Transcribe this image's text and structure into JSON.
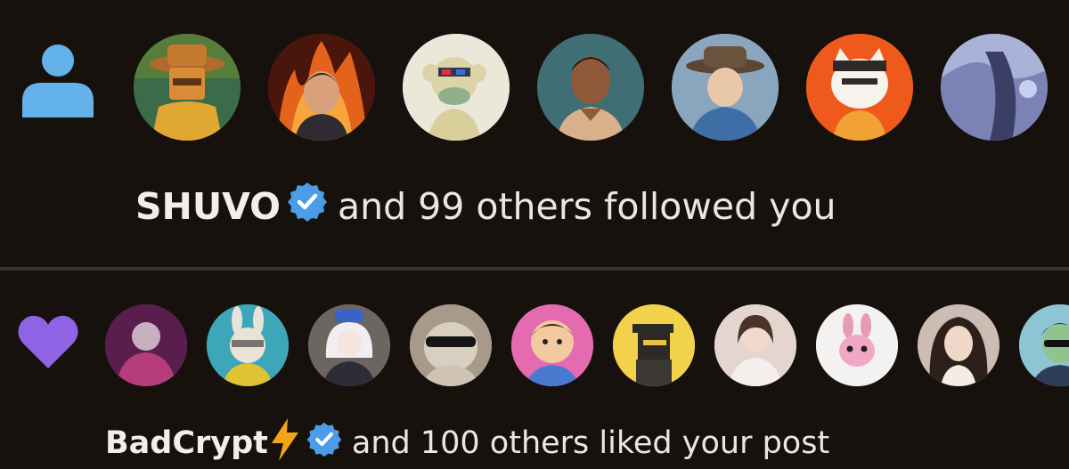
{
  "notifications": [
    {
      "type": "follow",
      "type_icon": "person-icon",
      "actor_name": "SHUVO",
      "actor_verified": true,
      "action_text": "and 99 others followed you",
      "avatars": [
        {
          "label": "Robot avatar",
          "bg": "#3c6b4a"
        },
        {
          "label": "Fire avatar",
          "bg": "#a63a14"
        },
        {
          "label": "Monkey avatar",
          "bg": "#e6e3d5"
        },
        {
          "label": "Man avatar",
          "bg": "#3f6e74"
        },
        {
          "label": "Hat avatar",
          "bg": "#7fa0bd"
        },
        {
          "label": "Cat avatar",
          "bg": "#ef5a1c"
        },
        {
          "label": "Blue avatar",
          "bg": "#7b83b4"
        }
      ]
    },
    {
      "type": "like",
      "type_icon": "heart-icon",
      "actor_name": "BadCrypt",
      "actor_bolt": "⚡",
      "actor_verified": true,
      "action_text": "and 100 others liked your post",
      "avatars": [
        {
          "label": "Pink avatar",
          "bg": "#9a3a8a"
        },
        {
          "label": "Bunny avatar",
          "bg": "#3da6b8"
        },
        {
          "label": "Anime avatar",
          "bg": "#6d6660"
        },
        {
          "label": "Cat shades avatar",
          "bg": "#a79a8a"
        },
        {
          "label": "Cartoon boy avatar",
          "bg": "#e56bb0"
        },
        {
          "label": "Pixel avatar",
          "bg": "#f2d14b"
        },
        {
          "label": "Girl avatar",
          "bg": "#e4d6cf"
        },
        {
          "label": "Pink bunny avatar",
          "bg": "#f4f2f0"
        },
        {
          "label": "Photo avatar",
          "bg": "#7a5448"
        },
        {
          "label": "Green avatar",
          "bg": "#8ec5d2"
        }
      ]
    }
  ],
  "colors": {
    "background": "#17110d",
    "divider": "#3a3531",
    "person_icon": "#64b2ea",
    "heart_icon": "#8e63e4",
    "verified_badge": "#4a9de6",
    "bolt": "#f4a417"
  }
}
